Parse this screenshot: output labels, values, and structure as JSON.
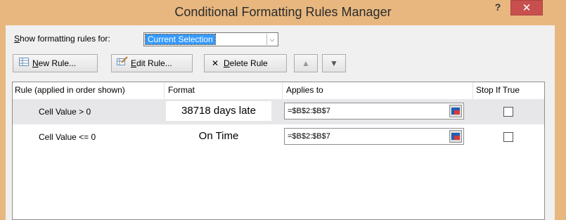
{
  "window": {
    "title": "Conditional Formatting Rules Manager",
    "help_label": "?",
    "close_label": "✕"
  },
  "show_rules": {
    "label_accel": "S",
    "label_rest": "how formatting rules for:",
    "selected": "Current Selection",
    "arrow": "⌵"
  },
  "toolbar": {
    "new_accel": "N",
    "new_rest": "ew Rule...",
    "edit_accel": "E",
    "edit_rest": "dit Rule...",
    "delete_icon": "✕",
    "delete_pre": "",
    "delete_accel": "D",
    "delete_rest": "elete Rule",
    "up_glyph": "▲",
    "down_glyph": "▼"
  },
  "columns": {
    "rule": "Rule (applied in order shown)",
    "format": "Format",
    "applies": "Applies to",
    "stop": "Stop If True"
  },
  "rules": [
    {
      "rule": "Cell Value > 0",
      "format": "38718 days late",
      "applies_to": "=$B$2:$B$7",
      "stop_if_true": false
    },
    {
      "rule": "Cell Value <= 0",
      "format": "On Time",
      "applies_to": "=$B$2:$B$7",
      "stop_if_true": false
    }
  ],
  "colors": {
    "title_bar": "#e7b77f",
    "close_button": "#c7504f",
    "selection": "#3399ff",
    "selected_row": "#e7e7ea"
  }
}
